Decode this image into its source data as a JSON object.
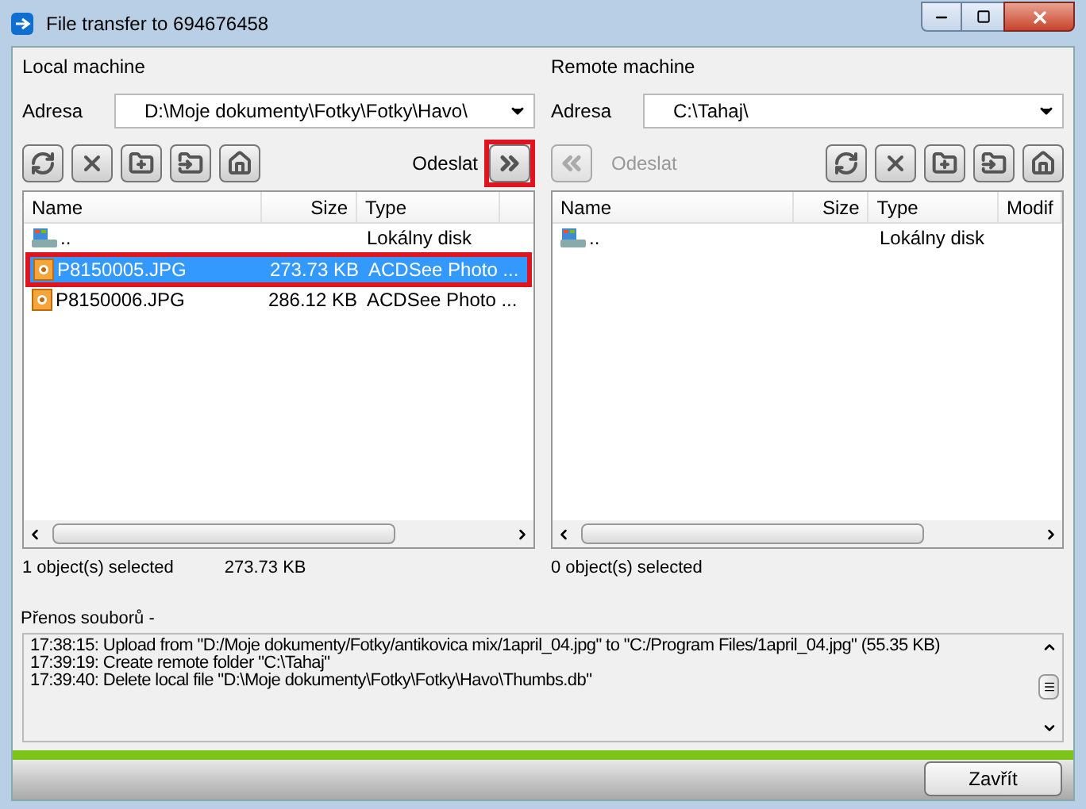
{
  "window": {
    "title": "File transfer to 694676458"
  },
  "panels": [
    {
      "kind": "local",
      "title": "Local machine",
      "address_label": "Adresa",
      "address": "D:\\Moje dokumenty\\Fotky\\Fotky\\Havo\\",
      "send": {
        "label": "Odeslat",
        "disabled": false,
        "highlighted": true
      },
      "columns": [
        "Name",
        "Size",
        "Type"
      ],
      "rows": [
        {
          "kind": "drive",
          "name": "..",
          "size": "",
          "type": "Lokálny disk",
          "selected": false,
          "highlighted": false
        },
        {
          "kind": "image",
          "name": "P8150005.JPG",
          "size": "273.73 KB",
          "type": "ACDSee Photo ...",
          "selected": true,
          "highlighted": true
        },
        {
          "kind": "image",
          "name": "P8150006.JPG",
          "size": "286.12 KB",
          "type": "ACDSee Photo ...",
          "selected": false,
          "highlighted": false
        }
      ],
      "status": "1 object(s) selected",
      "status_size": "273.73 KB"
    },
    {
      "kind": "remote",
      "title": "Remote machine",
      "address_label": "Adresa",
      "address": "C:\\Tahaj\\",
      "send": {
        "label": "Odeslat",
        "disabled": true,
        "highlighted": false
      },
      "columns": [
        "Name",
        "Size",
        "Type",
        "Modif"
      ],
      "rows": [
        {
          "kind": "drive",
          "name": "..",
          "size": "",
          "type": "Lokálny disk",
          "selected": false,
          "highlighted": false
        }
      ],
      "status": "0 object(s) selected"
    }
  ],
  "log": {
    "title": "Přenos souborů -",
    "lines": [
      "17:38:15: Upload from \"D:/Moje dokumenty/Fotky/antikovica mix/1april_04.jpg\" to \"C:/Program Files/1april_04.jpg\" (55.35 KB)",
      "17:39:19: Create remote folder \"C:\\Tahaj\"",
      "17:39:40: Delete local file \"D:\\Moje dokumenty\\Fotky\\Fotky\\Havo\\Thumbs.db\""
    ]
  },
  "close_button": "Zavřít"
}
